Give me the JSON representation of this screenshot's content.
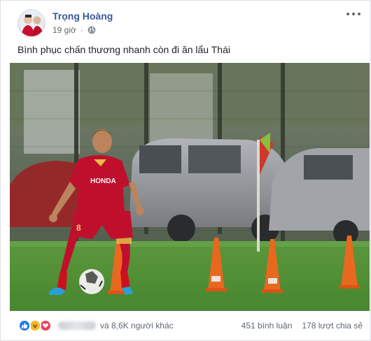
{
  "post": {
    "author": "Trọng Hoàng",
    "time": "19 giờ",
    "privacy_icon": "globe-icon",
    "text": "Bình phục chấn thương nhanh còn đi ăn lẩu Thái",
    "photo_jersey_text": "HONDA",
    "photo_jersey_number": "8"
  },
  "footer": {
    "reaction_icons": [
      "like-icon",
      "haha-icon",
      "love-icon"
    ],
    "others_text": "và 8,6K người khác",
    "comments": "451 bình luận",
    "shares": "178 lượt chia sẻ"
  },
  "colors": {
    "author_link": "#385898",
    "meta_text": "#616770",
    "like": "#1877f2",
    "haha": "#f7b928",
    "love": "#f33e58",
    "jersey": "#c8102e",
    "cone": "#f36d21"
  }
}
